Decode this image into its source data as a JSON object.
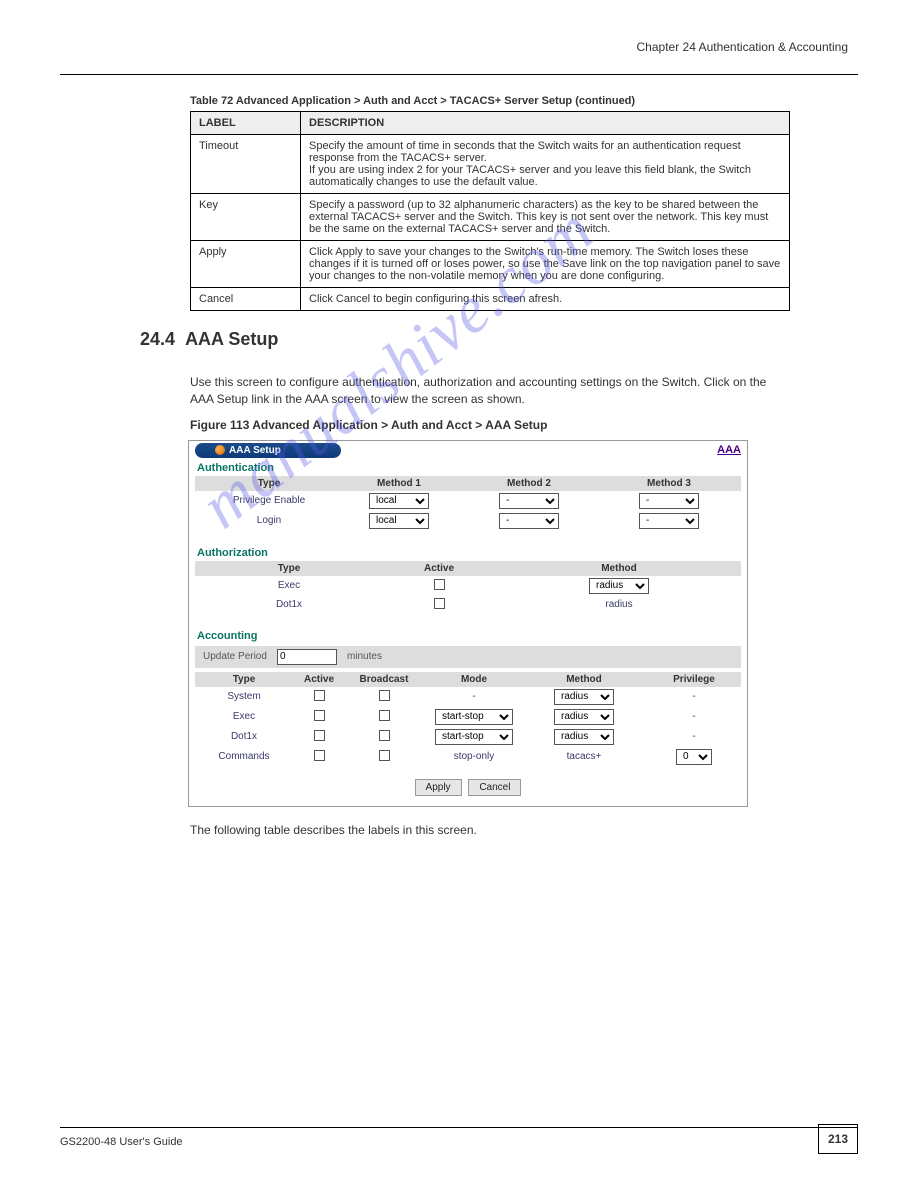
{
  "header_right": " Chapter 24 Authentication & Accounting",
  "table_caption": "Table 72   Advanced Application > Auth and Acct > TACACS+ Server Setup (continued)",
  "columns": {
    "label": "LABEL",
    "desc": "DESCRIPTION"
  },
  "rows": [
    {
      "label": "Timeout",
      "desc": "Specify the amount of time in seconds that the Switch waits for an authentication request response from the TACACS+ server.\nIf you are using index 2 for your TACACS+ server and you leave this field blank, the Switch automatically changes to use the default value."
    },
    {
      "label": "Key",
      "desc": "Specify a password (up to 32 alphanumeric characters) as the key to be shared between the external TACACS+ server and the Switch. This key is not sent over the network. This key must be the same on the external TACACS+ server and the Switch."
    },
    {
      "label": "Apply",
      "desc": "Click Apply to save your changes to the Switch's run-time memory. The Switch loses these changes if it is turned off or loses power, so use the Save link on the top navigation panel to save your changes to the non-volatile memory when you are done configuring."
    },
    {
      "label": "Cancel",
      "desc": "Click Cancel to begin configuring this screen afresh."
    }
  ],
  "section_number": "24.4",
  "section_title": "AAA Setup",
  "section_para": "Use this screen to configure authentication, authorization and accounting settings on the Switch. Click on the AAA Setup link in the AAA screen to view the screen as shown.",
  "figure_caption": "Figure 113   Advanced Application > Auth and Acct > AAA Setup",
  "screenshot": {
    "title": "AAA Setup",
    "toplink": "AAA",
    "authentication": {
      "title": "Authentication",
      "headers": [
        "Type",
        "Method 1",
        "Method 2",
        "Method 3"
      ],
      "rows": [
        {
          "type": "Privilege Enable",
          "m1": "local",
          "m2": "-",
          "m3": "-"
        },
        {
          "type": "Login",
          "m1": "local",
          "m2": "-",
          "m3": "-"
        }
      ]
    },
    "authorization": {
      "title": "Authorization",
      "headers": [
        "Type",
        "Active",
        "Method"
      ],
      "rows": [
        {
          "type": "Exec",
          "method": "radius",
          "is_select": true
        },
        {
          "type": "Dot1x",
          "method": "radius",
          "is_select": false
        }
      ]
    },
    "accounting": {
      "title": "Accounting",
      "update_label": "Update Period",
      "update_value": "0",
      "update_unit": "minutes",
      "headers": [
        "Type",
        "Active",
        "Broadcast",
        "Mode",
        "Method",
        "Privilege"
      ],
      "rows": [
        {
          "type": "System",
          "mode": "-",
          "mode_select": false,
          "method": "radius",
          "method_select": true,
          "priv": "-",
          "priv_select": false
        },
        {
          "type": "Exec",
          "mode": "start-stop",
          "mode_select": true,
          "method": "radius",
          "method_select": true,
          "priv": "-",
          "priv_select": false
        },
        {
          "type": "Dot1x",
          "mode": "start-stop",
          "mode_select": true,
          "method": "radius",
          "method_select": true,
          "priv": "-",
          "priv_select": false
        },
        {
          "type": "Commands",
          "mode": "stop-only",
          "mode_select": false,
          "method": "tacacs+",
          "method_select": false,
          "priv": "0",
          "priv_select": true
        }
      ]
    },
    "buttons": {
      "apply": "Apply",
      "cancel": "Cancel"
    }
  },
  "list_intro": "The following table describes the labels in this screen.",
  "footer_text": "GS2200-48 User's Guide",
  "page_number": "213",
  "watermark": "manualshive.com"
}
